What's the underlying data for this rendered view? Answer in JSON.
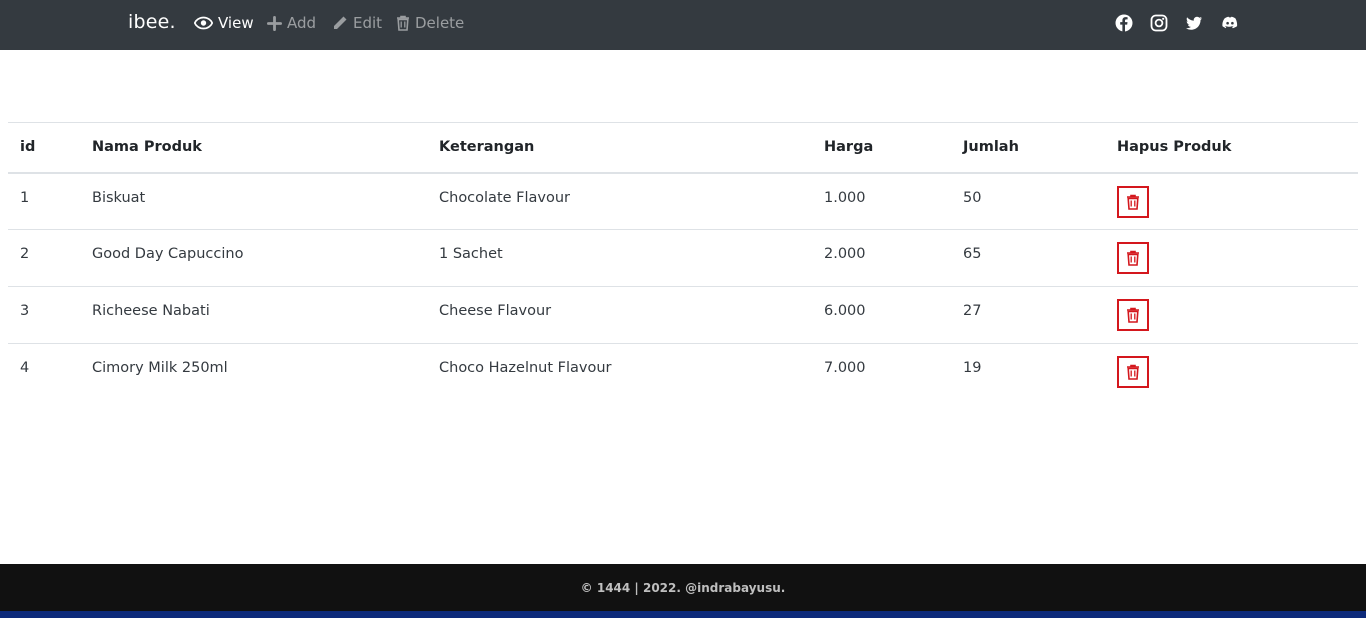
{
  "nav": {
    "brand": "ibee.",
    "items": [
      {
        "label": "View",
        "icon": "eye-icon",
        "active": true
      },
      {
        "label": "Add",
        "icon": "plus-icon",
        "active": false
      },
      {
        "label": "Edit",
        "icon": "pencil-icon",
        "active": false
      },
      {
        "label": "Delete",
        "icon": "trash-icon",
        "active": false
      }
    ],
    "social": [
      "facebook-icon",
      "instagram-icon",
      "twitter-icon",
      "discord-icon"
    ]
  },
  "table": {
    "headers": [
      "id",
      "Nama Produk",
      "Keterangan",
      "Harga",
      "Jumlah",
      "Hapus Produk"
    ],
    "rows": [
      {
        "id": "1",
        "name": "Biskuat",
        "desc": "Chocolate Flavour",
        "price": "1.000",
        "qty": "50"
      },
      {
        "id": "2",
        "name": "Good Day Capuccino",
        "desc": "1 Sachet",
        "price": "2.000",
        "qty": "65"
      },
      {
        "id": "3",
        "name": "Richeese Nabati",
        "desc": "Cheese Flavour",
        "price": "6.000",
        "qty": "27"
      },
      {
        "id": "4",
        "name": "Cimory Milk 250ml",
        "desc": "Choco Hazelnut Flavour",
        "price": "7.000",
        "qty": "19"
      }
    ]
  },
  "footer": {
    "text": "© 1444 | 2022. @indrabayusu."
  },
  "colors": {
    "navbar": "#343a40",
    "delete_accent": "#d4171d",
    "footer": "#111111",
    "footer_strip": "#0d2a7a"
  }
}
